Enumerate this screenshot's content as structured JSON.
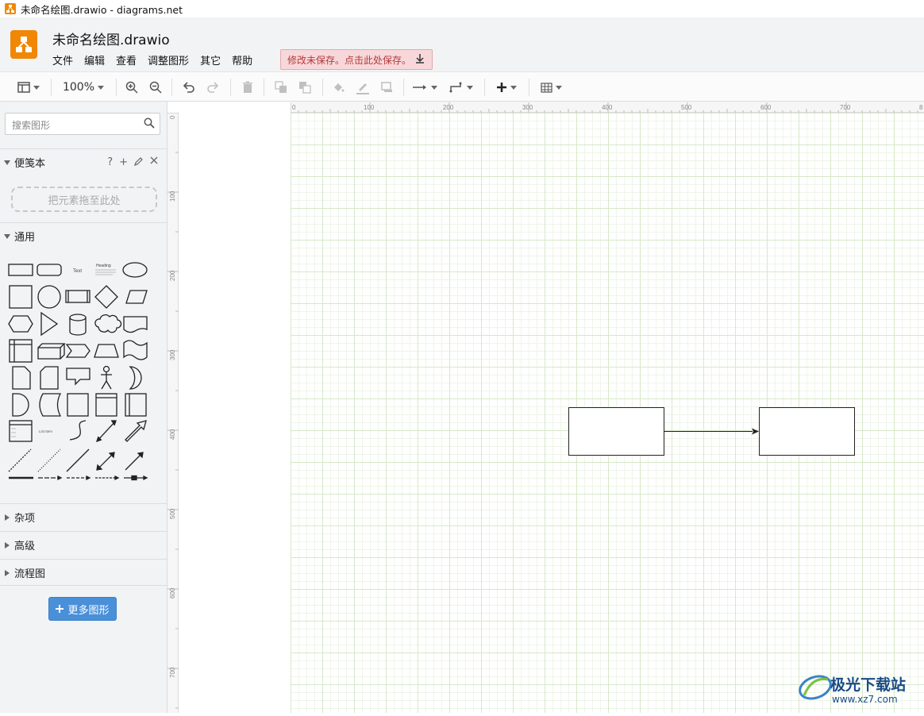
{
  "window": {
    "title": "未命名绘图.drawio - diagrams.net"
  },
  "app": {
    "doc_title": "未命名绘图.drawio",
    "menu": [
      "文件",
      "编辑",
      "查看",
      "调整图形",
      "其它",
      "帮助"
    ],
    "unsaved_notice": "修改未保存。点击此处保存。"
  },
  "toolbar": {
    "zoom": "100%",
    "buttons": [
      "format-panel",
      "zoom-in",
      "zoom-out",
      "undo",
      "redo",
      "delete",
      "to-front",
      "to-back",
      "fill-color",
      "line-color",
      "shadow",
      "connection",
      "waypoints",
      "insert",
      "table"
    ]
  },
  "sidebar": {
    "search_placeholder": "搜索图形",
    "scratchpad": {
      "title": "便笺本",
      "drop_hint": "把元素拖至此处",
      "actions": [
        "?",
        "+"
      ]
    },
    "general": {
      "title": "通用"
    },
    "sections": [
      "杂项",
      "高级",
      "流程图"
    ],
    "more_shapes": "更多图形",
    "shape_text": {
      "text": "Text",
      "heading": "Heading",
      "list_item": "List Item"
    }
  },
  "ruler": {
    "h_ticks": [
      "0",
      "100",
      "200",
      "300",
      "400",
      "500",
      "600",
      "700",
      "8"
    ],
    "v_ticks": [
      "0",
      "100",
      "200",
      "300",
      "400",
      "500",
      "600",
      "700"
    ]
  },
  "watermark": {
    "brand": "极光下载站",
    "url": "www.xz7.com"
  },
  "colors": {
    "accent": "#f08705",
    "button": "#4a90d9",
    "unsaved_bg": "#f8d7da",
    "grid": "#d7e8c9"
  }
}
